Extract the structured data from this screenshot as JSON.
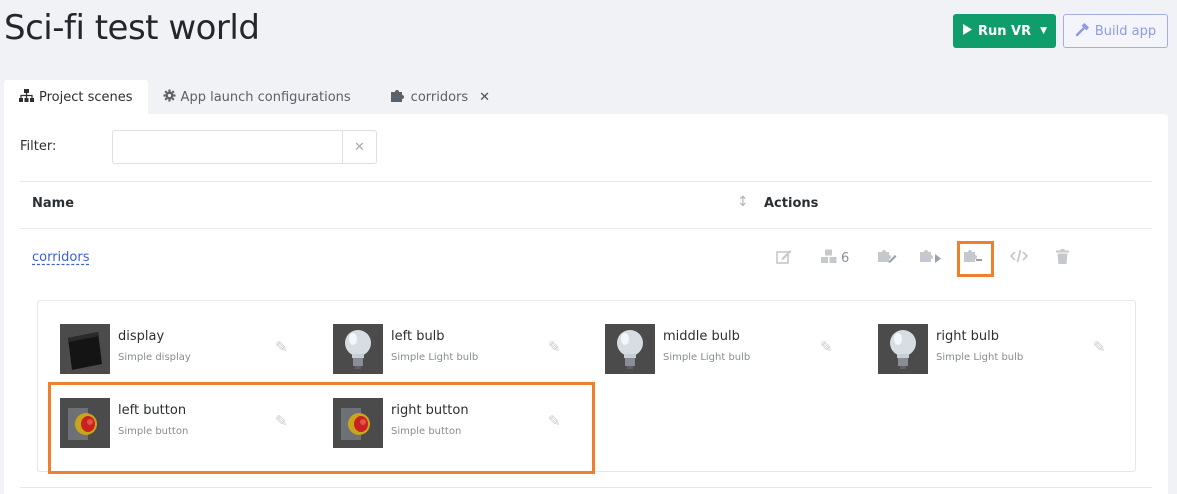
{
  "page": {
    "title": "Sci-fi test world"
  },
  "header": {
    "run_vr_label": "Run VR",
    "build_app_label": "Build app"
  },
  "tabs": [
    {
      "label": "Project scenes",
      "icon": "sitemap-icon",
      "active": true
    },
    {
      "label": "App launch configurations",
      "icon": "gear-icon",
      "active": false
    },
    {
      "label": "corridors",
      "icon": "puzzle-icon",
      "active": false,
      "closable": true
    }
  ],
  "filter": {
    "label": "Filter:",
    "value": "",
    "placeholder": ""
  },
  "table": {
    "headers": {
      "name": "Name",
      "actions": "Actions"
    },
    "rows": [
      {
        "name": "corridors",
        "object_count": "6"
      }
    ]
  },
  "objects": [
    {
      "name": "display",
      "type": "Simple display",
      "thumb": "display"
    },
    {
      "name": "left bulb",
      "type": "Simple Light bulb",
      "thumb": "bulb"
    },
    {
      "name": "middle bulb",
      "type": "Simple Light bulb",
      "thumb": "bulb"
    },
    {
      "name": "right bulb",
      "type": "Simple Light bulb",
      "thumb": "bulb"
    },
    {
      "name": "left button",
      "type": "Simple button",
      "thumb": "button"
    },
    {
      "name": "right button",
      "type": "Simple button",
      "thumb": "button"
    }
  ],
  "colors": {
    "accent_green": "#0f9d6b",
    "link_blue": "#3d5fcf",
    "highlight_orange": "#ee7f2d"
  }
}
